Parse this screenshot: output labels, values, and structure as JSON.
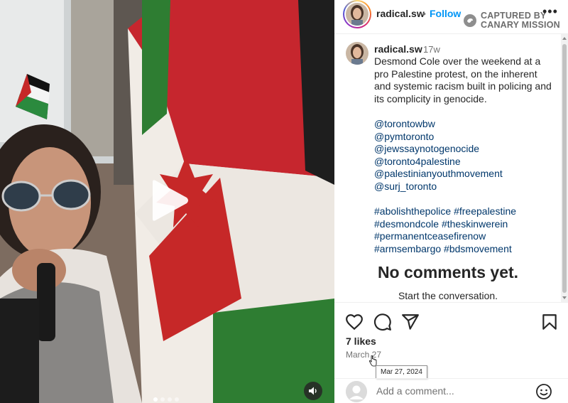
{
  "header": {
    "username": "radical.sw",
    "separator": "•",
    "follow_label": "Follow",
    "more_icon": "more-horizontal-icon",
    "watermark": {
      "line1": "CAPTURED BY",
      "line2": "CANARY MISSION",
      "icon": "canary-mission-logo"
    }
  },
  "caption": {
    "username": "radical.sw",
    "time": "17w",
    "text": "Desmond Cole over the weekend at a pro Palestine protest, on the inherent and systemic racism built in policing and its complicity in genocide.",
    "mentions": [
      "@torontowbw",
      "@pymtoronto",
      "@jewssaynotogenocide",
      "@toronto4palestine",
      "@palestinianyouthmovement",
      "@surj_toronto"
    ],
    "hashtags": [
      "#abolishthepolice",
      "#freepalestine",
      "#desmondcole",
      "#theskinwerein",
      "#permanentceasefirenow",
      "#armsembargo",
      "#bdsmovement"
    ]
  },
  "comments": {
    "empty_title": "No comments yet.",
    "empty_subtitle": "Start the conversation."
  },
  "actions": {
    "like_icon": "heart-icon",
    "comment_icon": "comment-icon",
    "share_icon": "share-icon",
    "save_icon": "bookmark-icon"
  },
  "likes": "7 likes",
  "date": "March 27",
  "tooltip": "Mar 27, 2024",
  "add_comment": {
    "placeholder": "Add a comment...",
    "emoji_icon": "emoji-icon"
  },
  "media": {
    "play_icon": "play-icon",
    "sound_icon": "speaker-icon",
    "carousel": {
      "count": 4,
      "active": 1
    }
  },
  "colors": {
    "accent": "#0095f6",
    "link": "#00376b",
    "text": "#262626",
    "secondary": "#737373"
  }
}
